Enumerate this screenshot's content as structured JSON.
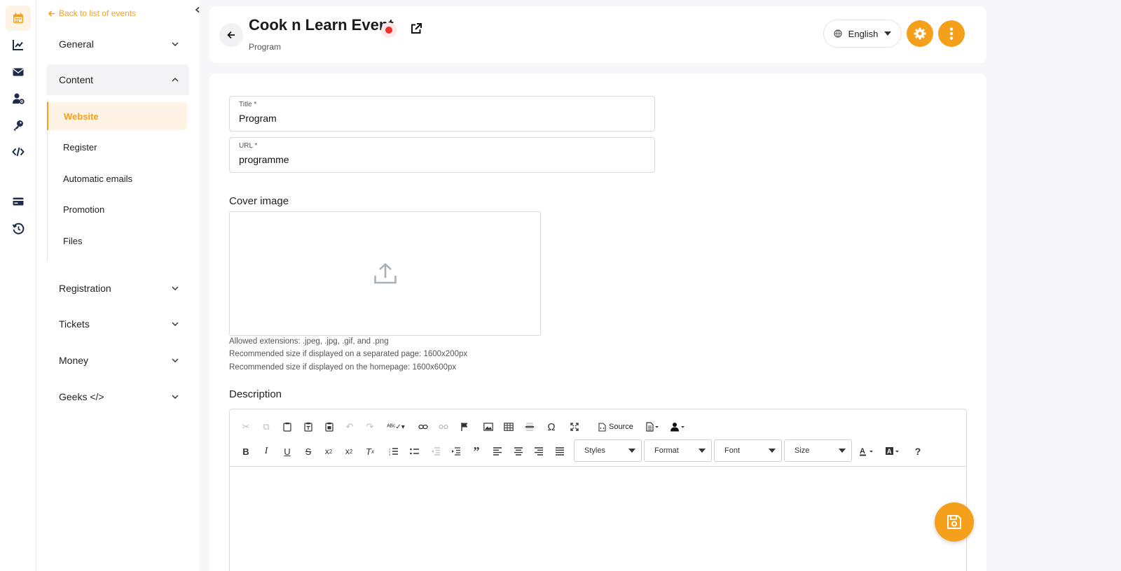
{
  "colors": {
    "accent": "#f5a01a",
    "recording": "#ef2e2e"
  },
  "rail": [
    "calendar-icon",
    "chart-line-icon",
    "envelope-icon",
    "user-cog-icon",
    "key-icon",
    "code-icon",
    "credit-card-icon",
    "history-icon"
  ],
  "sidebar": {
    "back_label": "Back to list of events",
    "sections": {
      "general": "General",
      "content": "Content",
      "registration": "Registration",
      "tickets": "Tickets",
      "money": "Money",
      "geeks": "Geeks </>"
    },
    "content_items": {
      "website": "Website",
      "register": "Register",
      "automatic_emails": "Automatic emails",
      "promotion": "Promotion",
      "files": "Files"
    }
  },
  "header": {
    "title": "Cook n Learn Event",
    "subtitle": "Program",
    "language": "English"
  },
  "form": {
    "title_label": "Title *",
    "title_value": "Program",
    "url_label": "URL *",
    "url_value": "programme",
    "cover_label": "Cover image",
    "hints": [
      "Allowed extensions: .jpeg, .jpg, .gif, and .png",
      "Recommended size if displayed on a separated page: 1600x200px",
      "Recommended size if displayed on the homepage: 1600x600px"
    ],
    "description_label": "Description"
  },
  "editor": {
    "source_label": "Source",
    "combos": {
      "styles": "Styles",
      "format": "Format",
      "font": "Font",
      "size": "Size"
    },
    "help_label": "?"
  }
}
